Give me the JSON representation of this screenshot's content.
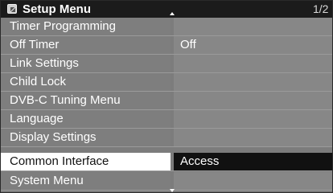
{
  "header": {
    "title": "Setup Menu",
    "page_indicator": "1/2",
    "icon": "setup-icon"
  },
  "items": [
    {
      "label": "Timer Programming",
      "value": ""
    },
    {
      "label": "Off Timer",
      "value": "Off"
    },
    {
      "label": "Link Settings",
      "value": ""
    },
    {
      "label": "Child Lock",
      "value": ""
    },
    {
      "label": "DVB-C Tuning Menu",
      "value": ""
    },
    {
      "label": "Language",
      "value": ""
    },
    {
      "label": "Display Settings",
      "value": ""
    },
    {
      "label": "Common Interface",
      "value": "Access",
      "selected": true
    },
    {
      "label": "System Menu",
      "value": ""
    }
  ],
  "colors": {
    "header_bg": "#1b1b1b",
    "row_bg": "#7e7e7e",
    "selected_label_bg": "#ffffff",
    "selected_value_bg": "#111111"
  }
}
